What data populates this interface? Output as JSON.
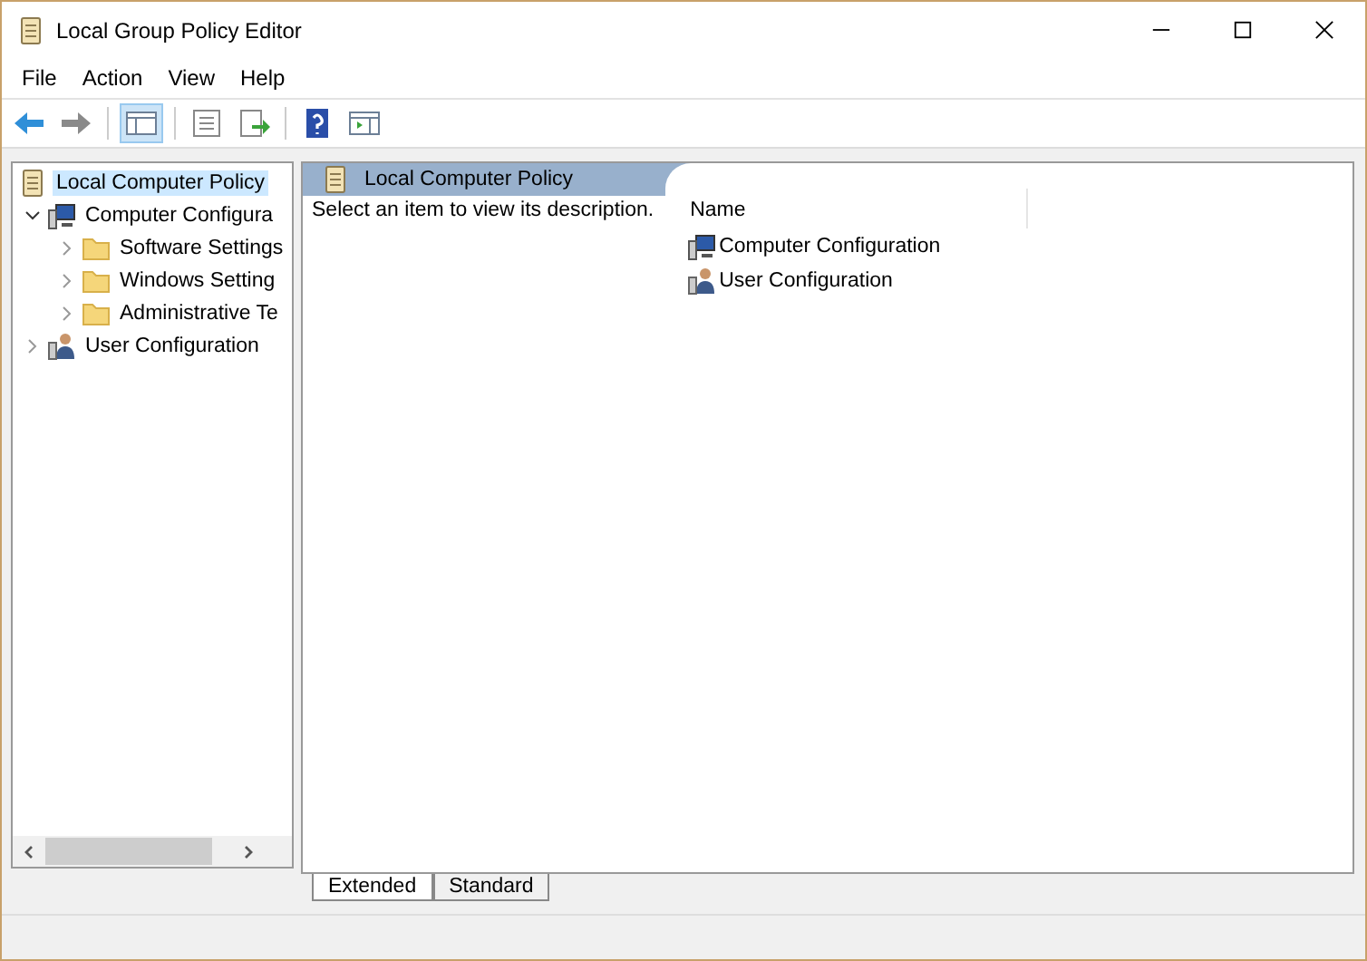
{
  "window": {
    "title": "Local Group Policy Editor"
  },
  "menu": [
    "File",
    "Action",
    "View",
    "Help"
  ],
  "tree": [
    {
      "label": "Local Computer Policy",
      "kind": "policy",
      "selected": true,
      "children": [
        {
          "label": "Computer Configura",
          "kind": "computer",
          "selected": false,
          "expanded": true,
          "children": [
            {
              "label": "Software Settings",
              "kind": "folder",
              "selected": false,
              "expanded": false
            },
            {
              "label": "Windows Setting",
              "kind": "folder",
              "selected": false,
              "expanded": false
            },
            {
              "label": "Administrative Te",
              "kind": "folder",
              "selected": false,
              "expanded": false
            }
          ]
        },
        {
          "label": "User Configuration",
          "kind": "user",
          "selected": false,
          "expanded": false
        }
      ]
    }
  ],
  "details": {
    "title": "Local Computer Policy",
    "description": "Select an item to view its description.",
    "column": "Name",
    "items": [
      {
        "label": "Computer Configuration",
        "kind": "computer"
      },
      {
        "label": "User Configuration",
        "kind": "user"
      }
    ]
  },
  "tabs": [
    {
      "label": "Extended",
      "selected": true
    },
    {
      "label": "Standard",
      "selected": false
    }
  ]
}
